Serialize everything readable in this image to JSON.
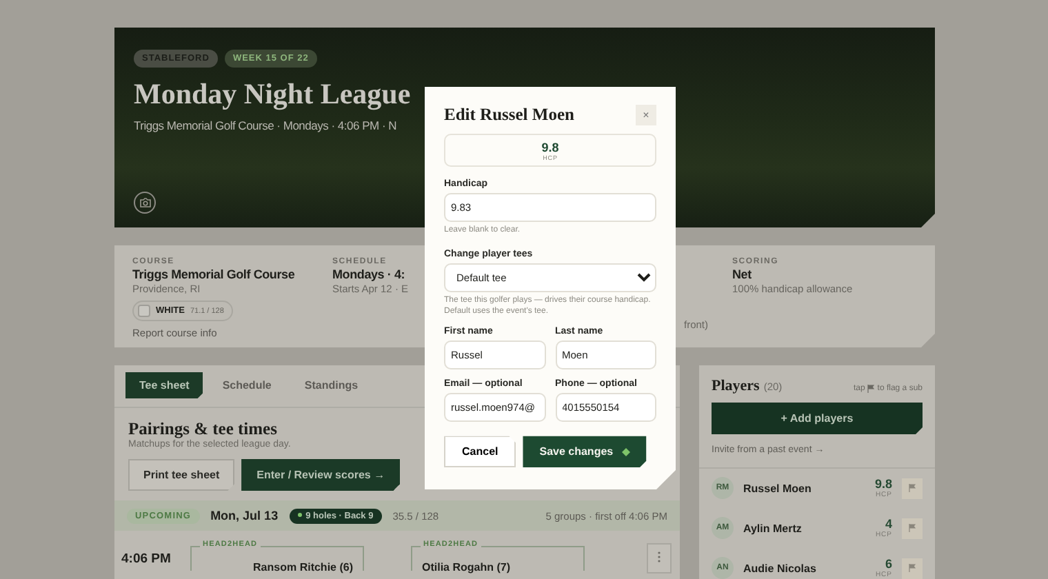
{
  "hero": {
    "badges": [
      {
        "label": "STABLEFORD",
        "kind": "format"
      },
      {
        "label": "WEEK 15 OF 22",
        "kind": "week"
      }
    ],
    "title": "Monday Night League",
    "subtitle": "Triggs Memorial Golf Course · Mondays · 4:06 PM · N"
  },
  "info": {
    "course": {
      "label": "COURSE",
      "name": "Triggs Memorial Golf Course",
      "location": "Providence, RI",
      "tee": {
        "name": "WHITE",
        "rating": "71.1 / 128"
      },
      "link": "Report course info"
    },
    "schedule": {
      "label": "SCHEDULE",
      "value": "Mondays · 4:",
      "detail": "Starts Apr 12 · E"
    },
    "column_3": {
      "detail": "front)"
    },
    "scoring": {
      "label": "SCORING",
      "value": "Net",
      "detail": "100% handicap allowance"
    }
  },
  "tabs": [
    {
      "label": "Tee sheet",
      "selected": true
    },
    {
      "label": "Schedule",
      "selected": false
    },
    {
      "label": "Standings",
      "selected": false
    }
  ],
  "pairings": {
    "title": "Pairings & tee times",
    "subtitle": "Matchups for the selected league day.",
    "buttons": [
      {
        "label": "Print tee sheet",
        "kind": "secondary"
      },
      {
        "label": "Enter / Review scores →",
        "kind": "primary"
      }
    ],
    "day": {
      "status": "UPCOMING",
      "date": "Mon, Jul 13",
      "holes": "9 holes · Back 9",
      "rating": "35.5 / 128",
      "summary": "5 groups · first off 4:06 PM"
    },
    "groups": [
      {
        "time": "4:06 PM",
        "matches": [
          {
            "label": "HEAD2HEAD",
            "player": "Ransom Ritchie (6)"
          },
          {
            "label": "HEAD2HEAD",
            "player": "Otilia Rogahn (7)"
          }
        ]
      }
    ]
  },
  "players": {
    "title": "Players",
    "count": "(20)",
    "hint_before": "tap",
    "hint_after": "to flag a sub",
    "add_button": "+ Add players",
    "invite_link": "Invite from a past event →",
    "rows": [
      {
        "initials": "RM",
        "name": "Russel Moen",
        "hcp": "9.8",
        "hcp_label": "HCP"
      },
      {
        "initials": "AM",
        "name": "Aylin Mertz",
        "hcp": "4",
        "hcp_label": "HCP"
      },
      {
        "initials": "AN",
        "name": "Audie Nicolas",
        "hcp": "6",
        "hcp_label": "HCP"
      }
    ]
  },
  "modal": {
    "title": "Edit Russel Moen",
    "close": "×",
    "hcp": {
      "value": "9.8",
      "label": "HCP"
    },
    "handicap": {
      "label": "Handicap",
      "value": "9.83",
      "hint": "Leave blank to clear."
    },
    "tees": {
      "label": "Change player tees",
      "value": "Default tee",
      "hint": "The tee this golfer plays — drives their course handicap. Default uses the event's tee."
    },
    "first_name": {
      "label": "First name",
      "value": "Russel"
    },
    "last_name": {
      "label": "Last name",
      "value": "Moen"
    },
    "email": {
      "label": "Email — optional",
      "value": "russel.moen974@"
    },
    "phone": {
      "label": "Phone — optional",
      "value": "4015550154"
    },
    "cancel": "Cancel",
    "save": "Save changes"
  }
}
